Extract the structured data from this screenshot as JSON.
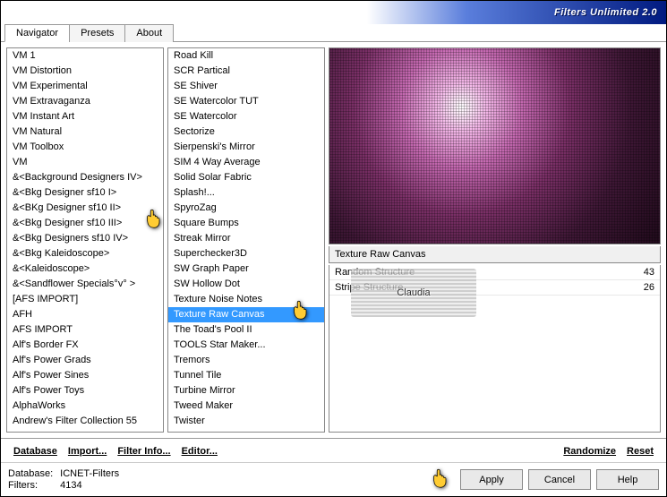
{
  "title": "Filters Unlimited 2.0",
  "tabs": [
    "Navigator",
    "Presets",
    "About"
  ],
  "activeTab": 0,
  "categories": [
    "VM 1",
    "VM Distortion",
    "VM Experimental",
    "VM Extravaganza",
    "VM Instant Art",
    "VM Natural",
    "VM Toolbox",
    "VM",
    "&<Background Designers IV>",
    "&<Bkg Designer sf10 I>",
    "&<BKg Designer sf10 II>",
    "&<Bkg Designer sf10 III>",
    "&<Bkg Designers sf10 IV>",
    "&<Bkg Kaleidoscope>",
    "&<Kaleidoscope>",
    "&<Sandflower Specials°v° >",
    "[AFS IMPORT]",
    "AFH",
    "AFS IMPORT",
    "Alf's Border FX",
    "Alf's Power Grads",
    "Alf's Power Sines",
    "Alf's Power Toys",
    "AlphaWorks",
    "Andrew's Filter Collection 55"
  ],
  "categorySelected": 11,
  "filters": [
    "Road Kill",
    "SCR  Partical",
    "SE Shiver",
    "SE Watercolor TUT",
    "SE Watercolor",
    "Sectorize",
    "Sierpenski's Mirror",
    "SIM 4 Way Average",
    "Solid Solar Fabric",
    "Splash!...",
    "SpyroZag",
    "Square Bumps",
    "Streak Mirror",
    "Superchecker3D",
    "SW Graph Paper",
    "SW Hollow Dot",
    "Texture Noise Notes",
    "Texture Raw Canvas",
    "The Toad's Pool II",
    "TOOLS Star Maker...",
    "Tremors",
    "Tunnel Tile",
    "Turbine Mirror",
    "Tweed Maker",
    "Twister"
  ],
  "filterSelected": 17,
  "presetName": "Texture Raw Canvas",
  "params": [
    {
      "name": "Random Structure",
      "value": "43"
    },
    {
      "name": "Stripe Structure",
      "value": "26"
    }
  ],
  "links": {
    "database": "Database",
    "import": "Import...",
    "filterInfo": "Filter Info...",
    "editor": "Editor...",
    "randomize": "Randomize",
    "reset": "Reset"
  },
  "status": {
    "dbLabel": "Database:",
    "dbValue": "ICNET-Filters",
    "filtersLabel": "Filters:",
    "filtersValue": "4134"
  },
  "buttons": {
    "apply": "Apply",
    "cancel": "Cancel",
    "help": "Help"
  },
  "watermark": "Claudia"
}
